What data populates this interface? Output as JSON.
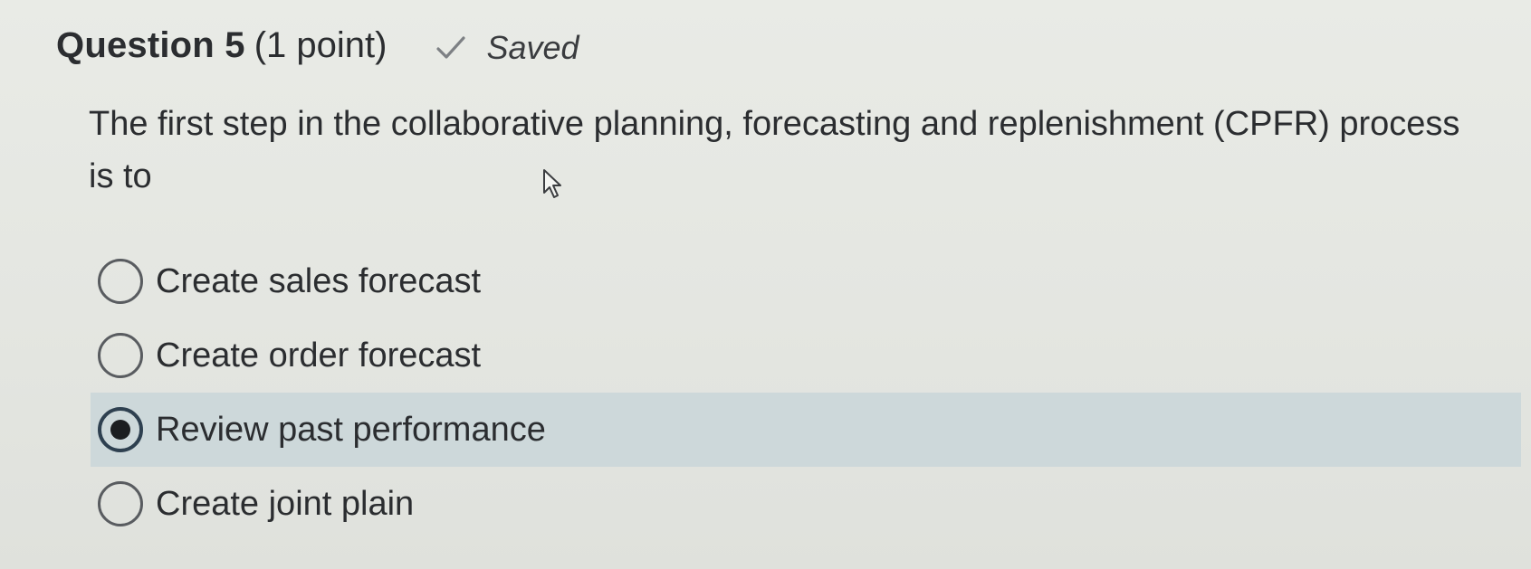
{
  "question": {
    "title": "Question 5",
    "points": "(1 point)",
    "status_icon": "check-icon",
    "status": "Saved",
    "text": "The first step in the collaborative planning, forecasting and replenishment (CPFR) process is to"
  },
  "options": [
    {
      "label": "Create sales forecast",
      "selected": false
    },
    {
      "label": "Create order forecast",
      "selected": false
    },
    {
      "label": "Review past performance",
      "selected": true
    },
    {
      "label": "Create joint plain",
      "selected": false
    }
  ],
  "colors": {
    "background": "#e6e8e3",
    "selected_row": "#cdd8da",
    "text": "#2b2d30"
  }
}
